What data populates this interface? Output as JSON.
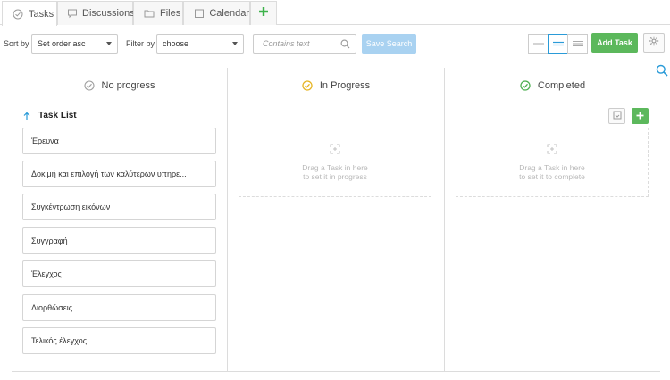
{
  "tabs": [
    {
      "label": "Tasks",
      "icon": "check-circle-icon",
      "active": true
    },
    {
      "label": "Discussions",
      "icon": "chat-icon",
      "active": false
    },
    {
      "label": "Files",
      "icon": "folder-icon",
      "active": false
    },
    {
      "label": "Calendar",
      "icon": "calendar-icon",
      "active": false
    }
  ],
  "toolbar": {
    "sort_label": "Sort by",
    "sort_value": "Set order asc",
    "filter_label": "Filter by",
    "filter_value": "choose",
    "search_placeholder": "Contains text",
    "save_search_label": "Save Search",
    "add_task_label": "Add Task"
  },
  "columns": [
    {
      "title": "No progress",
      "icon": "check-circle-grey-icon",
      "color": "#9e9e9e"
    },
    {
      "title": "In Progress",
      "icon": "check-circle-yellow-icon",
      "color": "#e6b422",
      "drop_line1": "Drag a Task in here",
      "drop_line2": "to set it in progress"
    },
    {
      "title": "Completed",
      "icon": "check-circle-green-icon",
      "color": "#4caf50",
      "drop_line1": "Drag a Task in here",
      "drop_line2": "to set it to complete"
    }
  ],
  "task_list": {
    "title": "Task List",
    "items": [
      "Έρευνα",
      "Δοκιμή και επιλογή των καλύτερων υπηρε...",
      "Συγκέντρωση εικόνων",
      "Συγγραφή",
      "Έλεγχος",
      "Διορθώσεις",
      "Τελικός έλεγχος"
    ]
  },
  "colors": {
    "accent_blue": "#2a9bd8",
    "save_search_bg": "#a9d2f1",
    "add_green": "#5cb85c"
  }
}
